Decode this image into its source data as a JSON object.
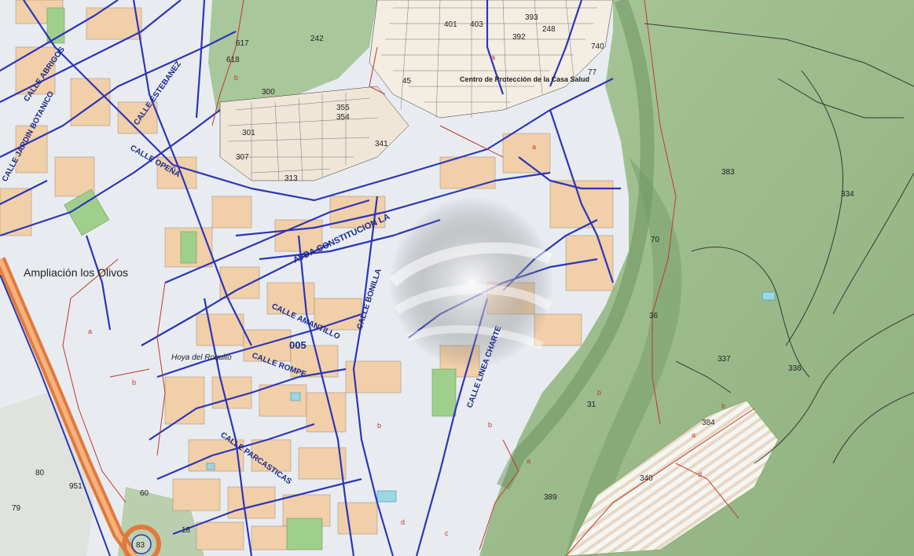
{
  "map": {
    "colors": {
      "terrain": "#9fbf8d",
      "terrain_dark": "#6f9a62",
      "urban": "#e9edf3",
      "block": "#f2d3b0",
      "street_line": "#2c35b8",
      "parcel_line": "#c0392b",
      "highway": "#e07a3c",
      "park": "#8bc47a",
      "water": "#9fd7e0"
    },
    "streets": [
      {
        "name": "CALLE JARDIN BOTANICO"
      },
      {
        "name": "CALLE ABRIGOS"
      },
      {
        "name": "CALLE ESTEBANEZ"
      },
      {
        "name": "CALLE OPEÑA"
      },
      {
        "name": "AVDA CONSTITUCION LA"
      },
      {
        "name": "CALLE AMANTILLO"
      },
      {
        "name": "CALLE ROMPE"
      },
      {
        "name": "CALLE PARCASTICAS"
      },
      {
        "name": "CALLE LINEA CHARTE"
      },
      {
        "name": "CALLE BONILLA"
      }
    ],
    "places": [
      {
        "name": "Ampliación los Olivos"
      },
      {
        "name": "Hoya del Roquito"
      },
      {
        "name": "Centro de Protección de la Casa Salud"
      }
    ],
    "sector_code": "005",
    "parcel_numbers": [
      "242",
      "300",
      "617",
      "618",
      "341",
      "355",
      "354",
      "393",
      "392",
      "401",
      "403",
      "248",
      "740",
      "77",
      "383",
      "334",
      "70",
      "337",
      "336",
      "31",
      "384",
      "340",
      "389",
      "80",
      "79",
      "951",
      "60",
      "83",
      "18",
      "36",
      "45",
      "301",
      "307",
      "313"
    ],
    "subparcel_letters": [
      "a",
      "b",
      "c",
      "d"
    ],
    "watermark_icon": "logo-globe-icon"
  }
}
